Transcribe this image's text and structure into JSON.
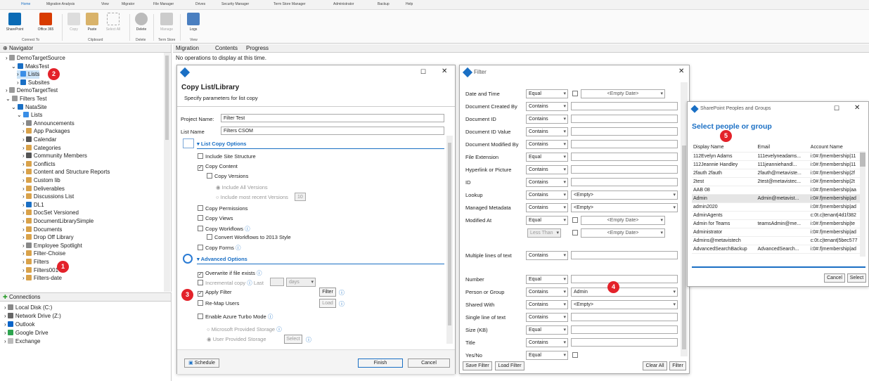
{
  "ribbon": {
    "tabs": [
      "Home",
      "Migration Analysis",
      "View",
      "Migrator",
      "File Manager",
      "Drives",
      "Security Manager",
      "Term Store Manager",
      "Administrator",
      "Backup",
      "Help"
    ],
    "buttons": [
      "SharePoint",
      "Office 365",
      "Copy",
      "Paste",
      "Select All",
      "Delete",
      "Manage",
      "Logs"
    ],
    "groups": [
      "Connect To",
      "Clipboard",
      "Delete",
      "Term Store",
      "View"
    ]
  },
  "navigator": {
    "title": "Navigator",
    "items": [
      "DemoTargetSource",
      "MaksTest",
      "Lists",
      "Subsites",
      "DemoTargetTest",
      "Filters Test",
      "NataSite",
      "Lists",
      "Announcements",
      "App Packages",
      "Calendar",
      "Categories",
      "Community Members",
      "Conflicts",
      "Content and Structure Reports",
      "Custom lib",
      "Deliverables",
      "Discussions List",
      "DL1",
      "DocSet Versioned",
      "DocumentLibrarySimple",
      "Documents",
      "Drop Off Library",
      "Employee Spotlight",
      "Filter-Choise",
      "Filters",
      "Filters001",
      "Filters-date"
    ]
  },
  "connections": {
    "title": "Connections",
    "items": [
      "Local Disk (C:)",
      "Network Drive (Z:)",
      "Outlook",
      "Google Drive",
      "Exchange"
    ]
  },
  "center_tabs": {
    "tabs": [
      "Migration",
      "Contents",
      "Progress"
    ],
    "status": "No operations to display at this time."
  },
  "copy_dialog": {
    "title": "Copy List/Library",
    "subtitle": "Specify parameters for list copy",
    "project_label": "Project Name:",
    "project_value": "Filter Test",
    "list_label": "List Name",
    "list_value": "Filters CSOM",
    "section1": "List Copy Options",
    "section2": "Advanced Options",
    "options": [
      "Include Site Structure",
      "Copy Content",
      "Copy Versions",
      "Include All Versions",
      "Include most recent Versions",
      "10",
      "Copy Permissions",
      "Copy Views",
      "Copy Workflows",
      "Convert Workflows to 2013 Style",
      "Copy Forms"
    ],
    "adv": [
      "Overwrite if file exists",
      "Incremental copy",
      "Last",
      "days",
      "Apply Filter",
      "Filter",
      "Re-Map Users",
      "Load",
      "Enable Azure Turbo Mode",
      "Microsoft Provided Storage",
      "User Provided Storage",
      "Select"
    ],
    "buttons": {
      "schedule": "Schedule",
      "finish": "Finish",
      "cancel": "Cancel"
    }
  },
  "filter_dialog": {
    "title": "Filter",
    "rows": [
      {
        "name": "Date and Time",
        "op": "Equal",
        "val": "<Empty Date>"
      },
      {
        "name": "Document Created By",
        "op": "Contains",
        "val": ""
      },
      {
        "name": "Document ID",
        "op": "Contains",
        "val": ""
      },
      {
        "name": "Document ID Value",
        "op": "Contains",
        "val": ""
      },
      {
        "name": "Document Modified By",
        "op": "Contains",
        "val": ""
      },
      {
        "name": "File Extension",
        "op": "Equal",
        "val": ""
      },
      {
        "name": "Hyperlink or Picture",
        "op": "Contains",
        "val": ""
      },
      {
        "name": "ID",
        "op": "Contains",
        "val": ""
      },
      {
        "name": "Lookup",
        "op": "Contains",
        "val": "<Empty>"
      },
      {
        "name": "Managed Metadata",
        "op": "Contains",
        "val": "<Empty>"
      },
      {
        "name": "Modified At",
        "op": "Equal",
        "val": "<Empty Date>"
      },
      {
        "name": "",
        "op": "Less Than",
        "val": "<Empty Date>"
      },
      {
        "name": "Multiple lines of text",
        "op": "Contains",
        "val": ""
      },
      {
        "name": "Number",
        "op": "Equal",
        "val": ""
      },
      {
        "name": "Person or Group",
        "op": "Contains",
        "val": "Admin"
      },
      {
        "name": "Shared With",
        "op": "Contains",
        "val": "<Empty>"
      },
      {
        "name": "Single line of text",
        "op": "Contains",
        "val": ""
      },
      {
        "name": "Size (KB)",
        "op": "Equal",
        "val": ""
      },
      {
        "name": "Title",
        "op": "Contains",
        "val": ""
      },
      {
        "name": "Yes/No",
        "op": "Equal",
        "val": ""
      }
    ],
    "buttons": {
      "save": "Save Filter",
      "load": "Load Filter",
      "clear": "Clear All",
      "filter": "Filter"
    }
  },
  "people_dialog": {
    "title": "SharePoint Peoples and Groups",
    "heading": "Select people or group",
    "columns": [
      "Display Name",
      "Email",
      "Account Name"
    ],
    "rows": [
      [
        "112Evelyn Adams",
        "111evelyneadams...",
        "i:0#.f|membership|11"
      ],
      [
        "112Jeannie Handley",
        "111jeanniehandl...",
        "i:0#.f|membership|11"
      ],
      [
        "2fauth 2fauth",
        "2fauth@metaviste...",
        "i:0#.f|membership|2f"
      ],
      [
        "2test",
        "2test@metavistec...",
        "i:0#.f|membership|2t"
      ],
      [
        "AAB 08",
        "",
        "i:0#.f|membership|aa"
      ],
      [
        "Admin",
        "Admin@metavist...",
        "i:0#.f|membership|ad"
      ],
      [
        "admin2020",
        "",
        "i:0#.f|membership|ad"
      ],
      [
        "AdminAgents",
        "",
        "c:0t.c|tenant|4d1f382"
      ],
      [
        "Admin for Teams",
        "teamsAdmin@me...",
        "i:0#.f|membership|te"
      ],
      [
        "Administrator",
        "",
        "i:0#.f|membership|ad"
      ],
      [
        "Admins@metavistech",
        "",
        "c:0t.c|tenant|5bec577"
      ],
      [
        "AdvancedSearchBackup",
        "AdvancedSearch...",
        "i:0#.f|membership|ad"
      ]
    ],
    "buttons": {
      "cancel": "Cancel",
      "select": "Select"
    }
  },
  "badges": [
    "1",
    "2",
    "3",
    "4",
    "5"
  ],
  "colors": {
    "accent": "#1a73c8",
    "badge": "#e3222a",
    "heading": "#1a6fc4"
  }
}
